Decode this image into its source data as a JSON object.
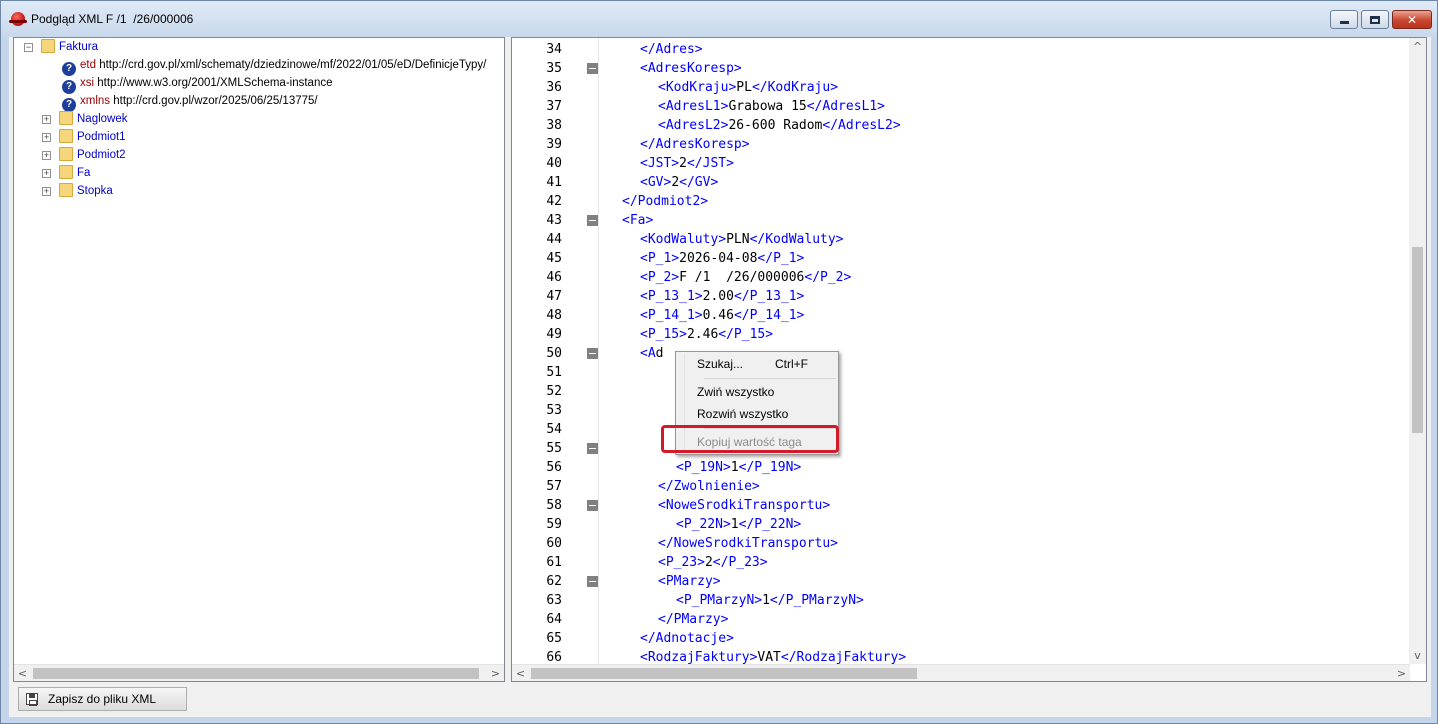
{
  "window": {
    "title": "Podgląd XML F /1  /26/000006",
    "minimize_glyph": "_",
    "maximize_glyph": "□",
    "close_glyph": "✕"
  },
  "tree": {
    "root": {
      "label": "Faktura",
      "expander": "−",
      "icon": "folder-icon"
    },
    "attributes": [
      {
        "name": "etd",
        "value": "http://crd.gov.pl/xml/schematy/dziedzinowe/mf/2022/01/05/eD/DefinicjeTypy/"
      },
      {
        "name": "xsi",
        "value": "http://www.w3.org/2001/XMLSchema-instance"
      },
      {
        "name": "xmlns",
        "value": "http://crd.gov.pl/wzor/2025/06/25/13775/"
      }
    ],
    "children": [
      {
        "label": "Naglowek",
        "expander": "+"
      },
      {
        "label": "Podmiot1",
        "expander": "+"
      },
      {
        "label": "Podmiot2",
        "expander": "+"
      },
      {
        "label": "Fa",
        "expander": "+"
      },
      {
        "label": "Stopka",
        "expander": "+"
      }
    ]
  },
  "code": {
    "lines": [
      {
        "n": "34",
        "indent": 2,
        "fold": false,
        "parts": [
          {
            "t": "tag",
            "v": "</Adres>"
          }
        ]
      },
      {
        "n": "35",
        "indent": 2,
        "fold": true,
        "parts": [
          {
            "t": "tag",
            "v": "<AdresKoresp>"
          }
        ]
      },
      {
        "n": "36",
        "indent": 3,
        "fold": false,
        "parts": [
          {
            "t": "tag",
            "v": "<KodKraju>"
          },
          {
            "t": "txt",
            "v": "PL"
          },
          {
            "t": "tag",
            "v": "</KodKraju>"
          }
        ]
      },
      {
        "n": "37",
        "indent": 3,
        "fold": false,
        "parts": [
          {
            "t": "tag",
            "v": "<AdresL1>"
          },
          {
            "t": "txt",
            "v": "Grabowa 15"
          },
          {
            "t": "tag",
            "v": "</AdresL1>"
          }
        ]
      },
      {
        "n": "38",
        "indent": 3,
        "fold": false,
        "parts": [
          {
            "t": "tag",
            "v": "<AdresL2>"
          },
          {
            "t": "txt",
            "v": "26-600 Radom"
          },
          {
            "t": "tag",
            "v": "</AdresL2>"
          }
        ]
      },
      {
        "n": "39",
        "indent": 2,
        "fold": false,
        "parts": [
          {
            "t": "tag",
            "v": "</AdresKoresp>"
          }
        ]
      },
      {
        "n": "40",
        "indent": 2,
        "fold": false,
        "parts": [
          {
            "t": "tag",
            "v": "<JST>"
          },
          {
            "t": "txt",
            "v": "2"
          },
          {
            "t": "tag",
            "v": "</JST>"
          }
        ]
      },
      {
        "n": "41",
        "indent": 2,
        "fold": false,
        "parts": [
          {
            "t": "tag",
            "v": "<GV>"
          },
          {
            "t": "txt",
            "v": "2"
          },
          {
            "t": "tag",
            "v": "</GV>"
          }
        ]
      },
      {
        "n": "42",
        "indent": 1,
        "fold": false,
        "parts": [
          {
            "t": "tag",
            "v": "</Podmiot2>"
          }
        ]
      },
      {
        "n": "43",
        "indent": 1,
        "fold": true,
        "parts": [
          {
            "t": "tag",
            "v": "<Fa>"
          }
        ]
      },
      {
        "n": "44",
        "indent": 2,
        "fold": false,
        "parts": [
          {
            "t": "tag",
            "v": "<KodWaluty>"
          },
          {
            "t": "txt",
            "v": "PLN"
          },
          {
            "t": "tag",
            "v": "</KodWaluty>"
          }
        ]
      },
      {
        "n": "45",
        "indent": 2,
        "fold": false,
        "parts": [
          {
            "t": "tag",
            "v": "<P_1>"
          },
          {
            "t": "txt",
            "v": "2026-04-08"
          },
          {
            "t": "tag",
            "v": "</P_1>"
          }
        ]
      },
      {
        "n": "46",
        "indent": 2,
        "fold": false,
        "parts": [
          {
            "t": "tag",
            "v": "<P_2>"
          },
          {
            "t": "txt",
            "v": "F /1  /26/000006"
          },
          {
            "t": "tag",
            "v": "</P_2>"
          }
        ]
      },
      {
        "n": "47",
        "indent": 2,
        "fold": false,
        "parts": [
          {
            "t": "tag",
            "v": "<P_13_1>"
          },
          {
            "t": "txt",
            "v": "2.00"
          },
          {
            "t": "tag",
            "v": "</P_13_1>"
          }
        ]
      },
      {
        "n": "48",
        "indent": 2,
        "fold": false,
        "parts": [
          {
            "t": "tag",
            "v": "<P_14_1>"
          },
          {
            "t": "txt",
            "v": "0.46"
          },
          {
            "t": "tag",
            "v": "</P_14_1>"
          }
        ]
      },
      {
        "n": "49",
        "indent": 2,
        "fold": false,
        "parts": [
          {
            "t": "tag",
            "v": "<P_15>"
          },
          {
            "t": "txt",
            "v": "2.46"
          },
          {
            "t": "tag",
            "v": "</P_15>"
          }
        ]
      },
      {
        "n": "50",
        "indent": 2,
        "fold": true,
        "parts": [
          {
            "t": "tag",
            "v": "<A"
          },
          {
            "t": "txt",
            "v": "d"
          }
        ]
      },
      {
        "n": "51",
        "indent": 3,
        "fold": false,
        "parts": []
      },
      {
        "n": "52",
        "indent": 3,
        "fold": false,
        "parts": []
      },
      {
        "n": "53",
        "indent": 3,
        "fold": false,
        "parts": []
      },
      {
        "n": "54",
        "indent": 3,
        "fold": false,
        "parts": []
      },
      {
        "n": "55",
        "indent": 3,
        "fold": true,
        "parts": []
      },
      {
        "n": "56",
        "indent": 4,
        "fold": false,
        "parts": [
          {
            "t": "tag",
            "v": "<P_19N>"
          },
          {
            "t": "txt",
            "v": "1"
          },
          {
            "t": "tag",
            "v": "</P_19N>"
          }
        ]
      },
      {
        "n": "57",
        "indent": 3,
        "fold": false,
        "parts": [
          {
            "t": "tag",
            "v": "</Zwolnienie>"
          }
        ]
      },
      {
        "n": "58",
        "indent": 3,
        "fold": true,
        "parts": [
          {
            "t": "tag",
            "v": "<NoweSrodkiTransportu>"
          }
        ]
      },
      {
        "n": "59",
        "indent": 4,
        "fold": false,
        "parts": [
          {
            "t": "tag",
            "v": "<P_22N>"
          },
          {
            "t": "txt",
            "v": "1"
          },
          {
            "t": "tag",
            "v": "</P_22N>"
          }
        ]
      },
      {
        "n": "60",
        "indent": 3,
        "fold": false,
        "parts": [
          {
            "t": "tag",
            "v": "</NoweSrodkiTransportu>"
          }
        ]
      },
      {
        "n": "61",
        "indent": 3,
        "fold": false,
        "parts": [
          {
            "t": "tag",
            "v": "<P_23>"
          },
          {
            "t": "txt",
            "v": "2"
          },
          {
            "t": "tag",
            "v": "</P_23>"
          }
        ]
      },
      {
        "n": "62",
        "indent": 3,
        "fold": true,
        "parts": [
          {
            "t": "tag",
            "v": "<PMarzy>"
          }
        ]
      },
      {
        "n": "63",
        "indent": 4,
        "fold": false,
        "parts": [
          {
            "t": "tag",
            "v": "<P_PMarzyN>"
          },
          {
            "t": "txt",
            "v": "1"
          },
          {
            "t": "tag",
            "v": "</P_PMarzyN>"
          }
        ]
      },
      {
        "n": "64",
        "indent": 3,
        "fold": false,
        "parts": [
          {
            "t": "tag",
            "v": "</PMarzy>"
          }
        ]
      },
      {
        "n": "65",
        "indent": 2,
        "fold": false,
        "parts": [
          {
            "t": "tag",
            "v": "</Adnotacje>"
          }
        ]
      },
      {
        "n": "66",
        "indent": 2,
        "fold": false,
        "parts": [
          {
            "t": "tag",
            "v": "<RodzajFaktury>"
          },
          {
            "t": "txt",
            "v": "VAT"
          },
          {
            "t": "tag",
            "v": "</RodzajFaktury>"
          }
        ]
      }
    ]
  },
  "context_menu": {
    "search_label": "Szukaj...",
    "search_shortcut": "Ctrl+F",
    "collapse_all": "Zwiń wszystko",
    "expand_all": "Rozwiń wszystko",
    "copy_tag_value": "Kopiuj wartość taga"
  },
  "scroll": {
    "left_arrow": "<",
    "right_arrow": ">",
    "up_arrow": "^",
    "down_arrow": "v"
  },
  "footer": {
    "save_button": "Zapisz do pliku XML"
  },
  "colors": {
    "tag": "#0000ff",
    "attr_name": "#990000",
    "highlight": "#d11a2a"
  }
}
